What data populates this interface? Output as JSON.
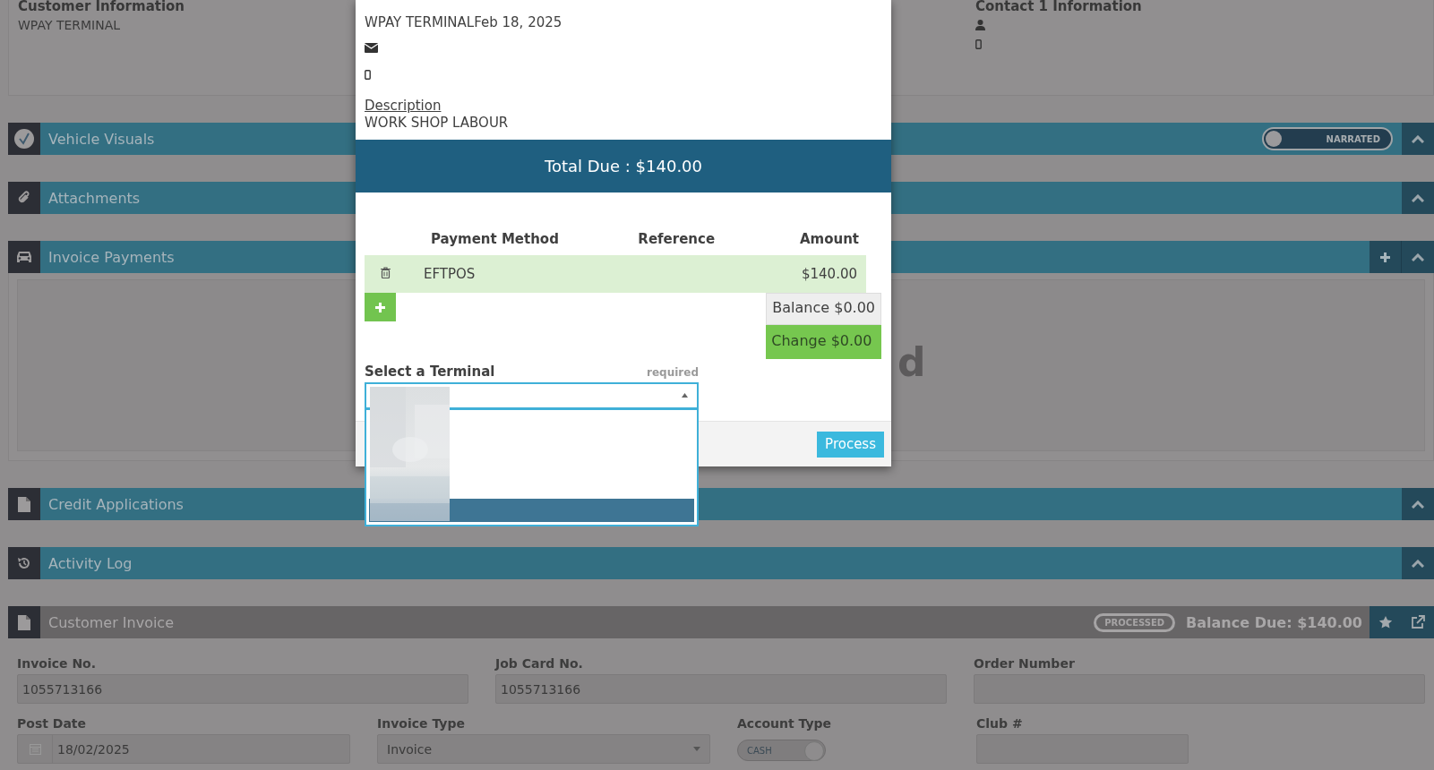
{
  "customer_info": {
    "title": "Customer Information",
    "name": "WPAY TERMINAL"
  },
  "contact_info": {
    "title": "Contact 1 Information"
  },
  "sections": [
    {
      "kind": "visuals",
      "title": "Vehicle Visuals",
      "toggle": {
        "label": "NARRATED",
        "on": false
      }
    },
    {
      "kind": "attachments",
      "title": "Attachments"
    },
    {
      "kind": "payments",
      "title": "Invoice Payments",
      "panel_text": "d"
    },
    {
      "kind": "credit",
      "title": "Credit Applications"
    },
    {
      "kind": "log",
      "title": "Activity Log"
    }
  ],
  "invoice": {
    "title": "Customer Invoice",
    "status": "PROCESSED",
    "balance_due": "Balance Due: $140.00",
    "fields": [
      {
        "kind": "text",
        "label": "Invoice No.",
        "value": "1055713166"
      },
      {
        "kind": "text",
        "label": "Job Card No.",
        "value": "1055713166"
      },
      {
        "kind": "empty",
        "label": "Order Number"
      },
      {
        "kind": "date",
        "label": "Post Date",
        "value": "18/02/2025"
      },
      {
        "kind": "select",
        "label": "Invoice Type",
        "value": "Invoice"
      },
      {
        "kind": "toggle",
        "label": "Account Type",
        "value": "CASH",
        "on": true
      },
      {
        "kind": "empty",
        "label": "Club #"
      }
    ]
  },
  "modal": {
    "header": "WPAY TERMINALFeb 18, 2025",
    "description_label": "Description",
    "description": "WORK SHOP LABOUR",
    "total_due": "Total Due : $140.00",
    "columns": [
      "Payment Method",
      "Reference",
      "Amount"
    ],
    "payments": [
      {
        "method": "EFTPOS",
        "amount": "$140.00"
      }
    ],
    "balance": "Balance $0.00",
    "change": "Change $0.00",
    "terminal": {
      "label": "Select a Terminal",
      "required": "required",
      "expanded": true,
      "options": [
        {
          "selected": true
        }
      ]
    },
    "process_button": "Process"
  }
}
